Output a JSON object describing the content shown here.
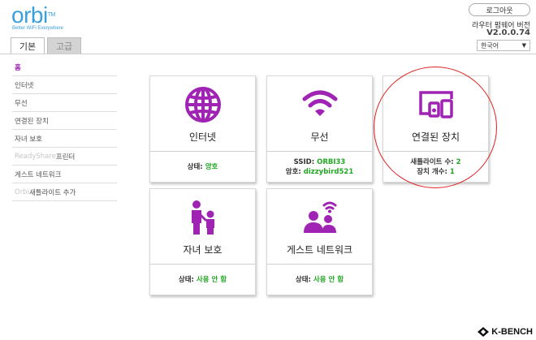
{
  "logo": {
    "text": "orbi",
    "tm": "TM",
    "tagline": "Better WiFi Everywhere"
  },
  "tabs": [
    {
      "label": "기본",
      "active": true
    },
    {
      "label": "고급",
      "active": false
    }
  ],
  "header": {
    "logout_label": "로그아웃",
    "firmware_label": "라우터 펌웨어 버전",
    "firmware_version": "V2.0.0.74",
    "language": "한국어"
  },
  "sidebar": {
    "items": [
      {
        "label": "홈",
        "active": true
      },
      {
        "label": "인터넷"
      },
      {
        "label": "무선"
      },
      {
        "label": "연결된 장치"
      },
      {
        "label": "자녀 보호"
      },
      {
        "dim_label": "ReadyShare",
        "label": " 프린터"
      },
      {
        "label": "게스트 네트워크"
      },
      {
        "dim_label": "Orbi",
        "label": "새틀라이트 추가"
      }
    ]
  },
  "cards": {
    "internet": {
      "title": "인터넷",
      "status_label": "상태:",
      "status_value": "양호"
    },
    "wireless": {
      "title": "무선",
      "ssid_label": "SSID:",
      "ssid_value": "ORBI33",
      "pw_label": "암호:",
      "pw_value": "dizzybird521"
    },
    "devices": {
      "title": "연결된 장치",
      "sat_label": "새틀라이트 수:",
      "sat_value": "2",
      "dev_label": "장치 개수:",
      "dev_value": "1"
    },
    "parental": {
      "title": "자녀 보호",
      "status_label": "상태:",
      "status_value": "사용 안 함"
    },
    "guest": {
      "title": "게스트 네트워크",
      "status_label": "상태:",
      "status_value": "사용 안 함"
    }
  },
  "watermark": {
    "text": "K-BENCH"
  },
  "colors": {
    "accent": "#a024b4",
    "ok": "#22a822",
    "logo": "#3aa0dc",
    "highlight": "#e02020"
  }
}
